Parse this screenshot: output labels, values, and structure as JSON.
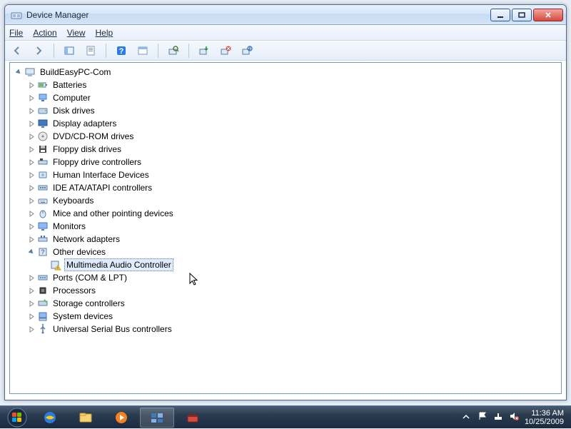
{
  "window": {
    "title": "Device Manager"
  },
  "menu": {
    "file": "File",
    "action": "Action",
    "view": "View",
    "help": "Help"
  },
  "tree": {
    "root": "BuildEasyPC-Com",
    "children": [
      {
        "label": "Batteries",
        "icon": "battery"
      },
      {
        "label": "Computer",
        "icon": "computer"
      },
      {
        "label": "Disk drives",
        "icon": "disk"
      },
      {
        "label": "Display adapters",
        "icon": "display"
      },
      {
        "label": "DVD/CD-ROM drives",
        "icon": "optical"
      },
      {
        "label": "Floppy disk drives",
        "icon": "floppy"
      },
      {
        "label": "Floppy drive controllers",
        "icon": "floppy-ctrl"
      },
      {
        "label": "Human Interface Devices",
        "icon": "hid"
      },
      {
        "label": "IDE ATA/ATAPI controllers",
        "icon": "ide"
      },
      {
        "label": "Keyboards",
        "icon": "keyboard"
      },
      {
        "label": "Mice and other pointing devices",
        "icon": "mouse"
      },
      {
        "label": "Monitors",
        "icon": "monitor"
      },
      {
        "label": "Network adapters",
        "icon": "network"
      },
      {
        "label": "Other devices",
        "icon": "unknown",
        "expanded": true,
        "children": [
          {
            "label": "Multimedia Audio Controller",
            "icon": "warn-device",
            "selected": true
          }
        ]
      },
      {
        "label": "Ports (COM & LPT)",
        "icon": "port"
      },
      {
        "label": "Processors",
        "icon": "cpu"
      },
      {
        "label": "Storage controllers",
        "icon": "storage"
      },
      {
        "label": "System devices",
        "icon": "system"
      },
      {
        "label": "Universal Serial Bus controllers",
        "icon": "usb"
      }
    ]
  },
  "clock": {
    "time": "11:36 AM",
    "date": "10/25/2009"
  }
}
